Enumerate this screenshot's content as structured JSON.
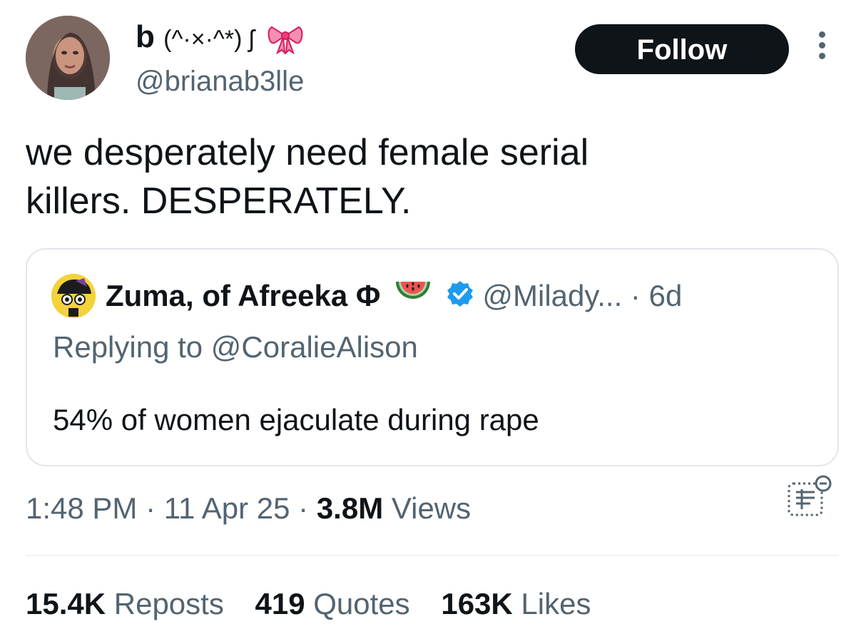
{
  "author": {
    "display_name_prefix": "b",
    "kaomoji": "(^·×·^*) ʃ",
    "bow_icon": "pink-ribbon-bow",
    "handle": "@brianab3lle",
    "follow_label": "Follow"
  },
  "tweet": {
    "text": "we desperately need female serial\nkillers. DESPERATELY."
  },
  "quote": {
    "name": "Zuma, of Afreeka Φ",
    "watermelon_icon": "watermelon",
    "verified_icon": "verified-badge",
    "handle": "@Milady...",
    "separator": "·",
    "time": "6d",
    "replying_to": "Replying to @CoralieAlison",
    "text": "54% of women ejaculate during rape"
  },
  "meta": {
    "time": "1:48 PM",
    "date": "11 Apr 25",
    "sep": "·",
    "views_count": "3.8M",
    "views_label": "Views"
  },
  "stats": {
    "reposts_count": "15.4K",
    "reposts_label": "Reposts",
    "quotes_count": "419",
    "quotes_label": "Quotes",
    "likes_count": "163K",
    "likes_label": "Likes"
  },
  "colors": {
    "text": "#0f1419",
    "secondary": "#536471",
    "follow_bg": "#0f1419",
    "verified": "#1d9bf0",
    "border": "#e1e6ea"
  }
}
